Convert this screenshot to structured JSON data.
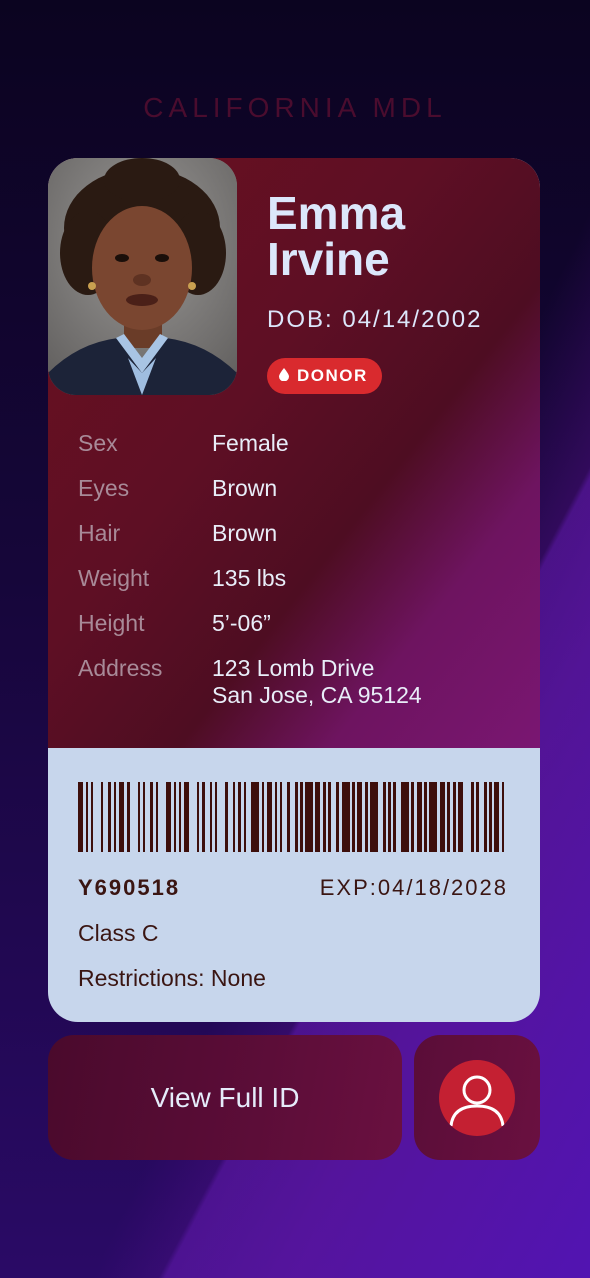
{
  "header": {
    "state_title": "CALIFORNIA MDL"
  },
  "card": {
    "name_first": "Emma",
    "name_last": "Irvine",
    "dob": "DOB: 04/14/2002",
    "donor_label": "DONOR",
    "fields": [
      {
        "label": "Sex",
        "value": "Female"
      },
      {
        "label": "Eyes",
        "value": "Brown"
      },
      {
        "label": "Hair",
        "value": "Brown"
      },
      {
        "label": "Weight",
        "value": "135 lbs"
      },
      {
        "label": "Height",
        "value": "5’-06”"
      },
      {
        "label": "Address",
        "value": "123 Lomb Drive",
        "value2": "San Jose, CA 95124"
      }
    ],
    "id_number": "Y690518",
    "expiration": "EXP:04/18/2028",
    "class": "Class C",
    "restrictions": "Restrictions: None"
  },
  "actions": {
    "view_full_id": "View Full ID",
    "profile_icon": "user-icon"
  },
  "colors": {
    "donor_badge": "#d92a2e",
    "card_top": "#5e0f24",
    "card_bottom": "#c7d6ec",
    "profile_circle": "#c42032"
  }
}
